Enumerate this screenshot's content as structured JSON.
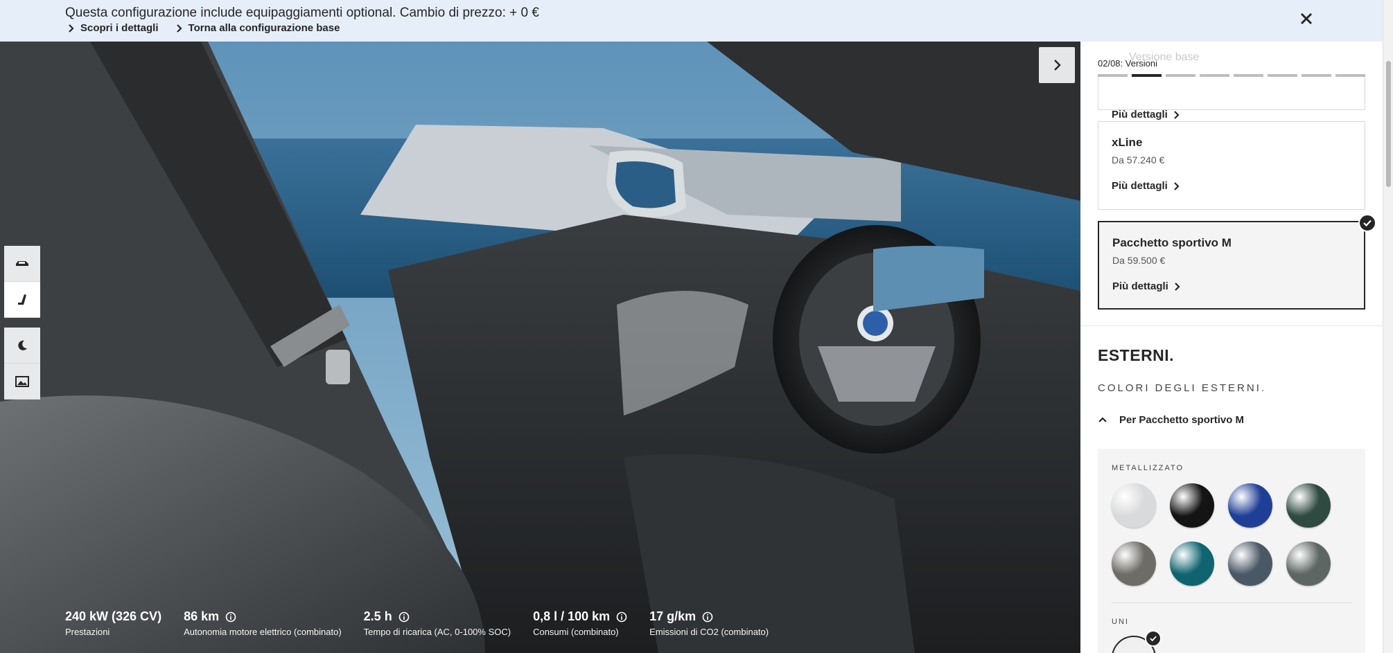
{
  "banner": {
    "message": "Questa configurazione include equipaggiamenti optional. Cambio di prezzo: + 0 €",
    "links": [
      "Scopri i dettagli",
      "Torna alla configurazione base"
    ],
    "close_icon": "close-icon"
  },
  "viewer": {
    "next_icon": "chevron-right-icon",
    "tools": [
      "car-exterior-icon",
      "interior-seat-icon",
      "night-mode-icon",
      "background-image-icon"
    ]
  },
  "specs": [
    {
      "value": "240 kW (326 CV)",
      "label": "Prestazioni",
      "info": false
    },
    {
      "value": "86 km",
      "label": "Autonomia motore elettrico (combinato)",
      "info": true
    },
    {
      "value": "2.5 h",
      "label": "Tempo di ricarica (AC, 0-100% SOC)",
      "info": true
    },
    {
      "value": "0,8 l / 100 km",
      "label": "Consumi (combinato)",
      "info": true
    },
    {
      "value": "17 g/km",
      "label": "Emissioni di CO2 (combinato)",
      "info": true
    }
  ],
  "panel": {
    "faded_header": "Versione base",
    "step": {
      "label": "02/08: Versioni",
      "total": 8,
      "current": 2
    },
    "details_label": "Più dettagli",
    "versions": [
      {
        "name": "xLine",
        "price": "Da 57.240 €",
        "selected": false
      },
      {
        "name": "Pacchetto sportivo M",
        "price": "Da 59.500 €",
        "selected": true
      }
    ],
    "section_title": "ESTERNI.",
    "section_subtitle": "COLORI DEGLI ESTERNI.",
    "group_label": "Per Pacchetto sportivo M",
    "categories": {
      "metallic": "METALLIZZATO",
      "solid": "UNI"
    },
    "metallic_colors": [
      "#d9dadb",
      "#141414",
      "#1f3f96",
      "#2f4a40",
      "#6d6c66",
      "#0f6470",
      "#4a5866",
      "#5d6663"
    ],
    "solid_colors": [
      "#f0f0f0"
    ]
  }
}
